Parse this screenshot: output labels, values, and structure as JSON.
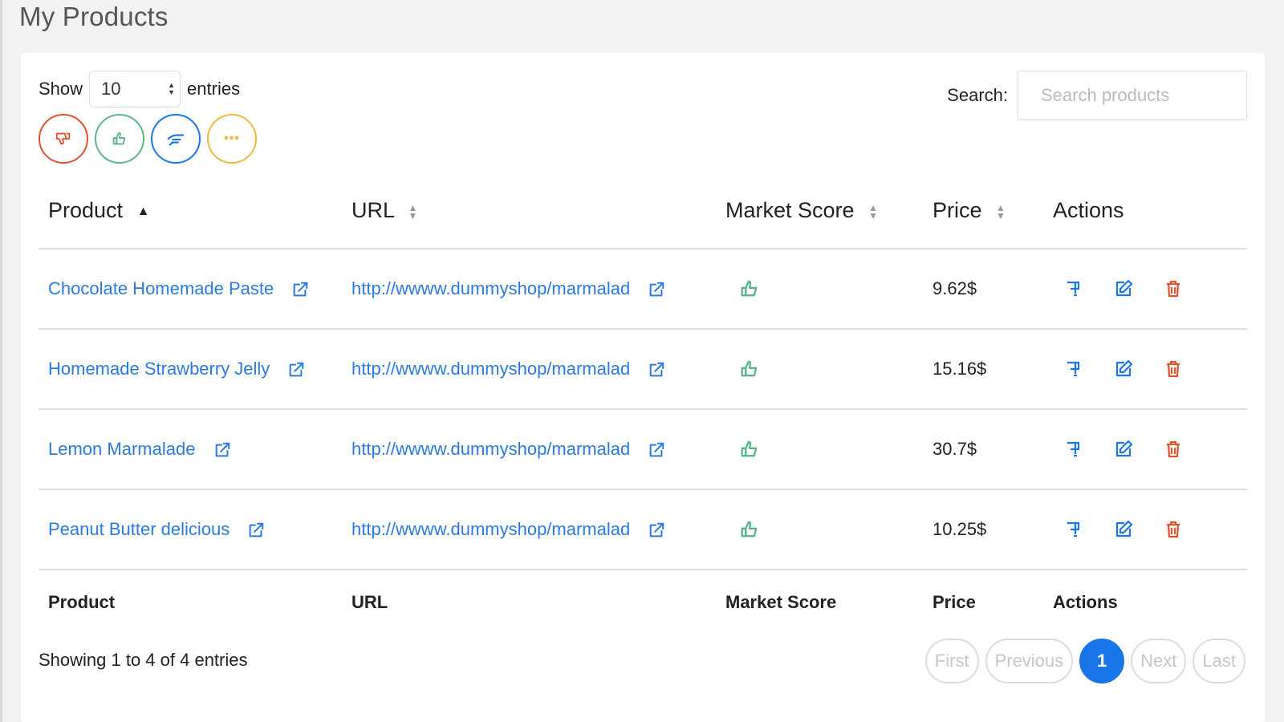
{
  "page": {
    "title": "My Products"
  },
  "length": {
    "show_label": "Show",
    "value": "10",
    "entries_label": "entries"
  },
  "filters": [
    {
      "name": "thumbs-down",
      "color": "#e0512c"
    },
    {
      "name": "thumbs-up",
      "color": "#5cb58a"
    },
    {
      "name": "hand-point",
      "color": "#1a76e8"
    },
    {
      "name": "more",
      "color": "#f0b73c"
    }
  ],
  "search": {
    "label": "Search:",
    "placeholder": "Search products"
  },
  "table": {
    "headers": {
      "product": "Product",
      "url": "URL",
      "score": "Market Score",
      "price": "Price",
      "actions": "Actions"
    },
    "rows": [
      {
        "product": "Chocolate Homemade Paste",
        "url": "http://wwww.dummyshop/marmalad",
        "score_icon": "thumbs-up-icon",
        "price": "9.62$"
      },
      {
        "product": "Homemade Strawberry Jelly",
        "url": "http://wwww.dummyshop/marmalad",
        "score_icon": "thumbs-up-icon",
        "price": "15.16$"
      },
      {
        "product": "Lemon Marmalade",
        "url": "http://wwww.dummyshop/marmalad",
        "score_icon": "thumbs-up-icon",
        "price": "30.7$"
      },
      {
        "product": "Peanut Butter delicious",
        "url": "http://wwww.dummyshop/marmalad",
        "score_icon": "thumbs-up-icon",
        "price": "10.25$"
      }
    ],
    "footer": {
      "product": "Product",
      "url": "URL",
      "score": "Market Score",
      "price": "Price",
      "actions": "Actions"
    }
  },
  "info": "Showing 1 to 4 of 4 entries",
  "pagination": {
    "first": "First",
    "previous": "Previous",
    "current": "1",
    "next": "Next",
    "last": "Last"
  },
  "colors": {
    "link": "#2a7ae2",
    "primary": "#1a76e8",
    "danger": "#e0512c",
    "success": "#5cb58a",
    "warning": "#f0b73c"
  }
}
